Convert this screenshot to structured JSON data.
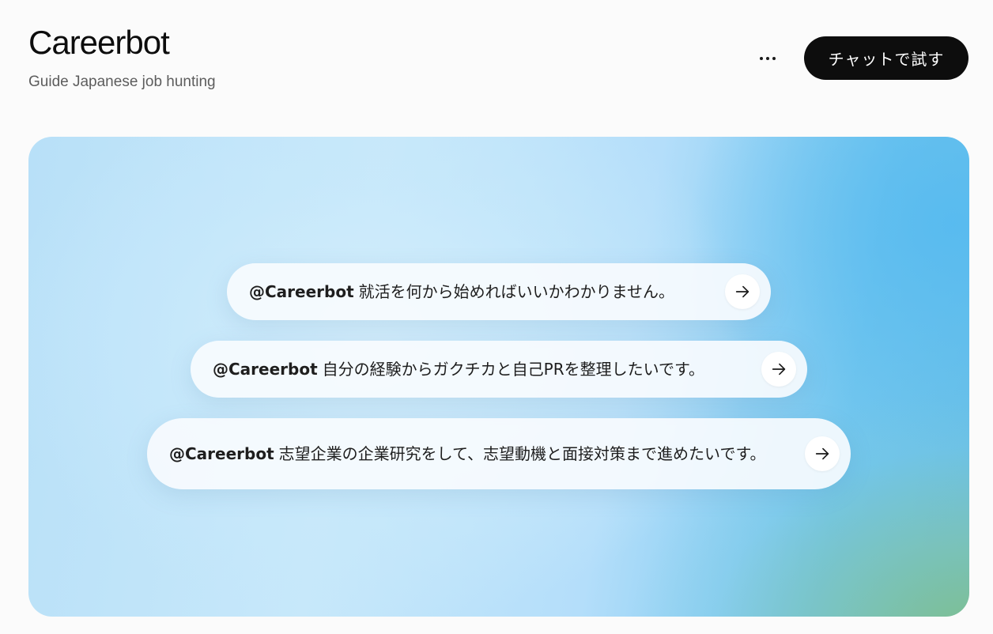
{
  "header": {
    "title": "Careerbot",
    "subtitle": "Guide Japanese job hunting",
    "try_button_label": "チャットで試す"
  },
  "prompts": [
    {
      "mention": "@Careerbot",
      "text": "就活を何から始めればいいかわかりません。"
    },
    {
      "mention": "@Careerbot",
      "text": "自分の経験からガクチカと自己PRを整理したいです。"
    },
    {
      "mention": "@Careerbot",
      "text": "志望企業の企業研究をして、志望動機と面接対策まで進めたいです。"
    }
  ],
  "icons": {
    "more": "more-horizontal-icon",
    "arrow": "arrow-right-icon"
  },
  "colors": {
    "button_bg": "#0d0d0d",
    "page_bg": "#fbfbfb",
    "hero_blue": "#69bfe6",
    "hero_green": "#7ebe8c"
  }
}
